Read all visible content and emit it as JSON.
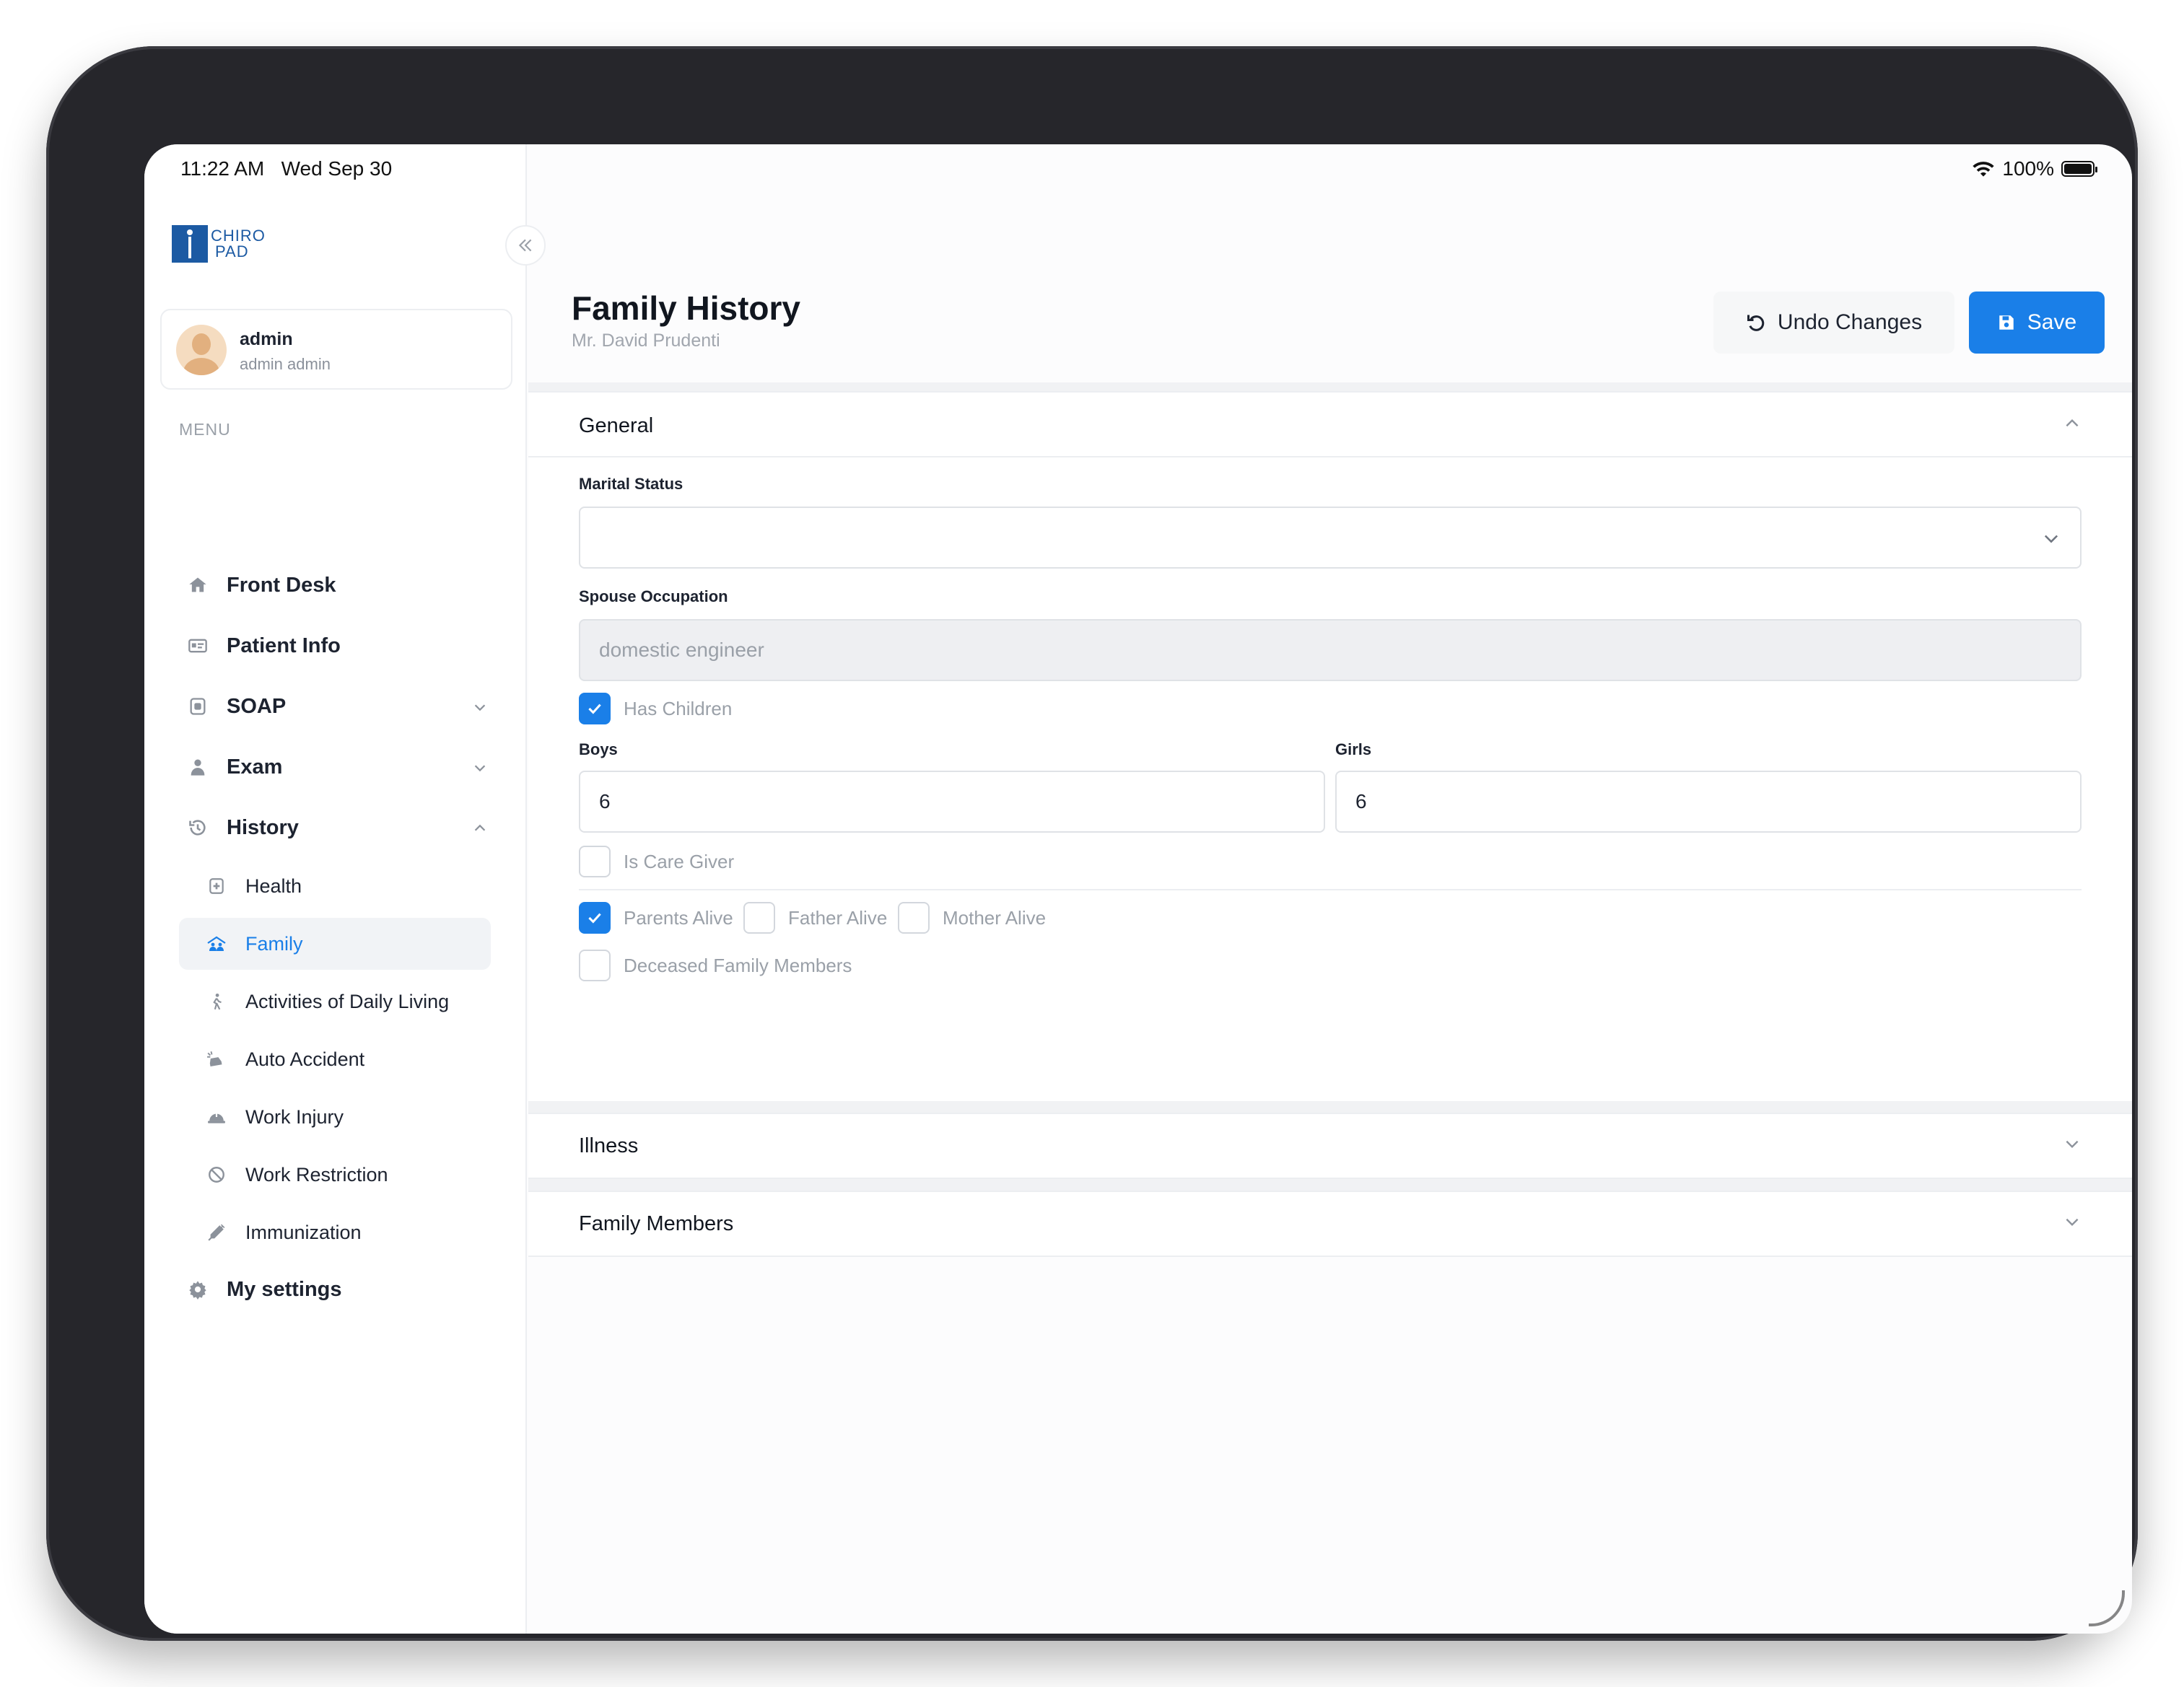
{
  "status_bar": {
    "time": "11:22 AM",
    "date": "Wed Sep 30",
    "battery": "100%"
  },
  "brand": {
    "line1": "CHIRO",
    "line2": "PAD"
  },
  "user": {
    "name": "admin",
    "subtitle": "admin admin"
  },
  "menu": {
    "title": "MENU",
    "items": [
      {
        "label": "Front Desk",
        "icon": "home-icon"
      },
      {
        "label": "Patient Info",
        "icon": "id-card-icon"
      },
      {
        "label": "SOAP",
        "icon": "document-icon"
      },
      {
        "label": "Exam",
        "icon": "person-icon"
      },
      {
        "label": "History",
        "icon": "history-icon"
      },
      {
        "label": "My settings",
        "icon": "gear-icon"
      }
    ],
    "history_sub": [
      {
        "label": "Health",
        "icon": "document-plus-icon"
      },
      {
        "label": "Family",
        "icon": "family-icon"
      },
      {
        "label": "Activities of Daily Living",
        "icon": "walking-icon"
      },
      {
        "label": "Auto Accident",
        "icon": "car-crash-icon"
      },
      {
        "label": "Work Injury",
        "icon": "hard-hat-icon"
      },
      {
        "label": "Work Restriction",
        "icon": "ban-icon"
      },
      {
        "label": "Immunization",
        "icon": "syringe-icon"
      }
    ]
  },
  "header": {
    "title": "Family History",
    "patient": "Mr. David Prudenti",
    "undo_label": "Undo Changes",
    "save_label": "Save"
  },
  "general": {
    "title": "General",
    "marital_status_label": "Marital Status",
    "marital_status_value": "",
    "spouse_occupation_label": "Spouse Occupation",
    "spouse_occupation_value": "domestic engineer",
    "has_children_label": "Has Children",
    "has_children": true,
    "boys_label": "Boys",
    "boys_value": "6",
    "girls_label": "Girls",
    "girls_value": "6",
    "care_giver_label": "Is Care Giver",
    "care_giver": false,
    "parents_alive_label": "Parents Alive",
    "parents_alive": true,
    "father_alive_label": "Father Alive",
    "father_alive": false,
    "mother_alive_label": "Mother Alive",
    "mother_alive": false,
    "deceased_label": "Deceased Family Members",
    "deceased": false
  },
  "sections": {
    "illness": "Illness",
    "family_members": "Family Members"
  },
  "colors": {
    "accent": "#1a7fe8",
    "text": "#1d2330",
    "muted": "#9aa0a8"
  }
}
